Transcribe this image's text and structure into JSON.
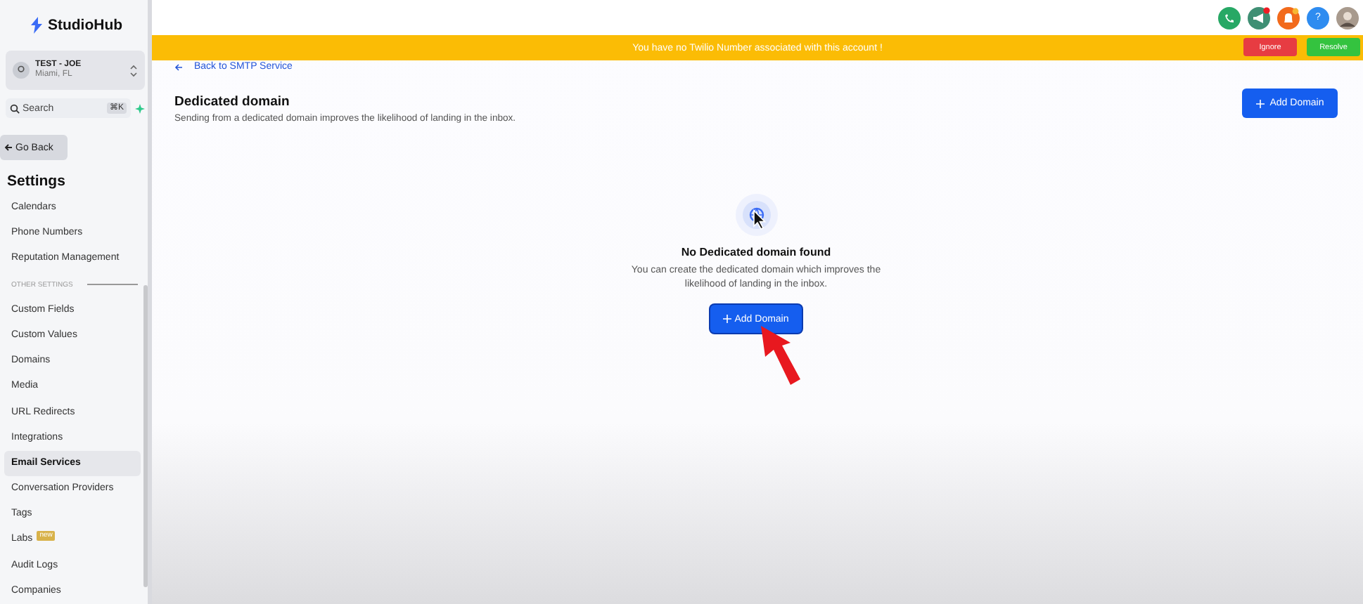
{
  "brand": {
    "name": "StudioHub"
  },
  "account": {
    "name": "TEST - JOE",
    "location": "Miami, FL"
  },
  "search": {
    "placeholder": "Search",
    "shortcut": "⌘K"
  },
  "go_back": "Go Back",
  "settings_title": "Settings",
  "sidebar": {
    "items": [
      {
        "kind": "item",
        "label": "Calendars",
        "selected": false
      },
      {
        "kind": "item",
        "label": "Phone Numbers",
        "selected": false
      },
      {
        "kind": "item",
        "label": "Reputation Management",
        "selected": false
      },
      {
        "kind": "section",
        "label": "OTHER SETTINGS"
      },
      {
        "kind": "item",
        "label": "Custom Fields",
        "selected": false
      },
      {
        "kind": "item",
        "label": "Custom Values",
        "selected": false
      },
      {
        "kind": "item",
        "label": "Domains",
        "selected": false
      },
      {
        "kind": "item",
        "label": "Media",
        "selected": false
      },
      {
        "kind": "item",
        "label": "URL Redirects",
        "selected": false
      },
      {
        "kind": "item",
        "label": "Integrations",
        "selected": false
      },
      {
        "kind": "item",
        "label": "Email Services",
        "selected": true
      },
      {
        "kind": "item",
        "label": "Conversation Providers",
        "selected": false
      },
      {
        "kind": "item",
        "label": "Tags",
        "selected": false
      },
      {
        "kind": "item",
        "label": "Labs",
        "selected": false,
        "badge": "new"
      },
      {
        "kind": "item",
        "label": "Audit Logs",
        "selected": false
      },
      {
        "kind": "item",
        "label": "Companies",
        "selected": false
      }
    ]
  },
  "header": {
    "help": "?"
  },
  "banner": {
    "message": "You have no Twilio Number associated with this account !",
    "buttons": [
      {
        "label": "Ignore",
        "kind": "danger"
      },
      {
        "label": "Resolve",
        "kind": "success"
      }
    ]
  },
  "back_link": "Back to SMTP Service",
  "page": {
    "title": "Dedicated domain",
    "subtitle": "Sending from a dedicated domain improves the likelihood of landing in the inbox.",
    "add_button": "Add Domain"
  },
  "empty_state": {
    "title": "No Dedicated domain found",
    "text": "You can create the dedicated domain which improves the likelihood of landing in the inbox.",
    "button": "Add Domain"
  }
}
